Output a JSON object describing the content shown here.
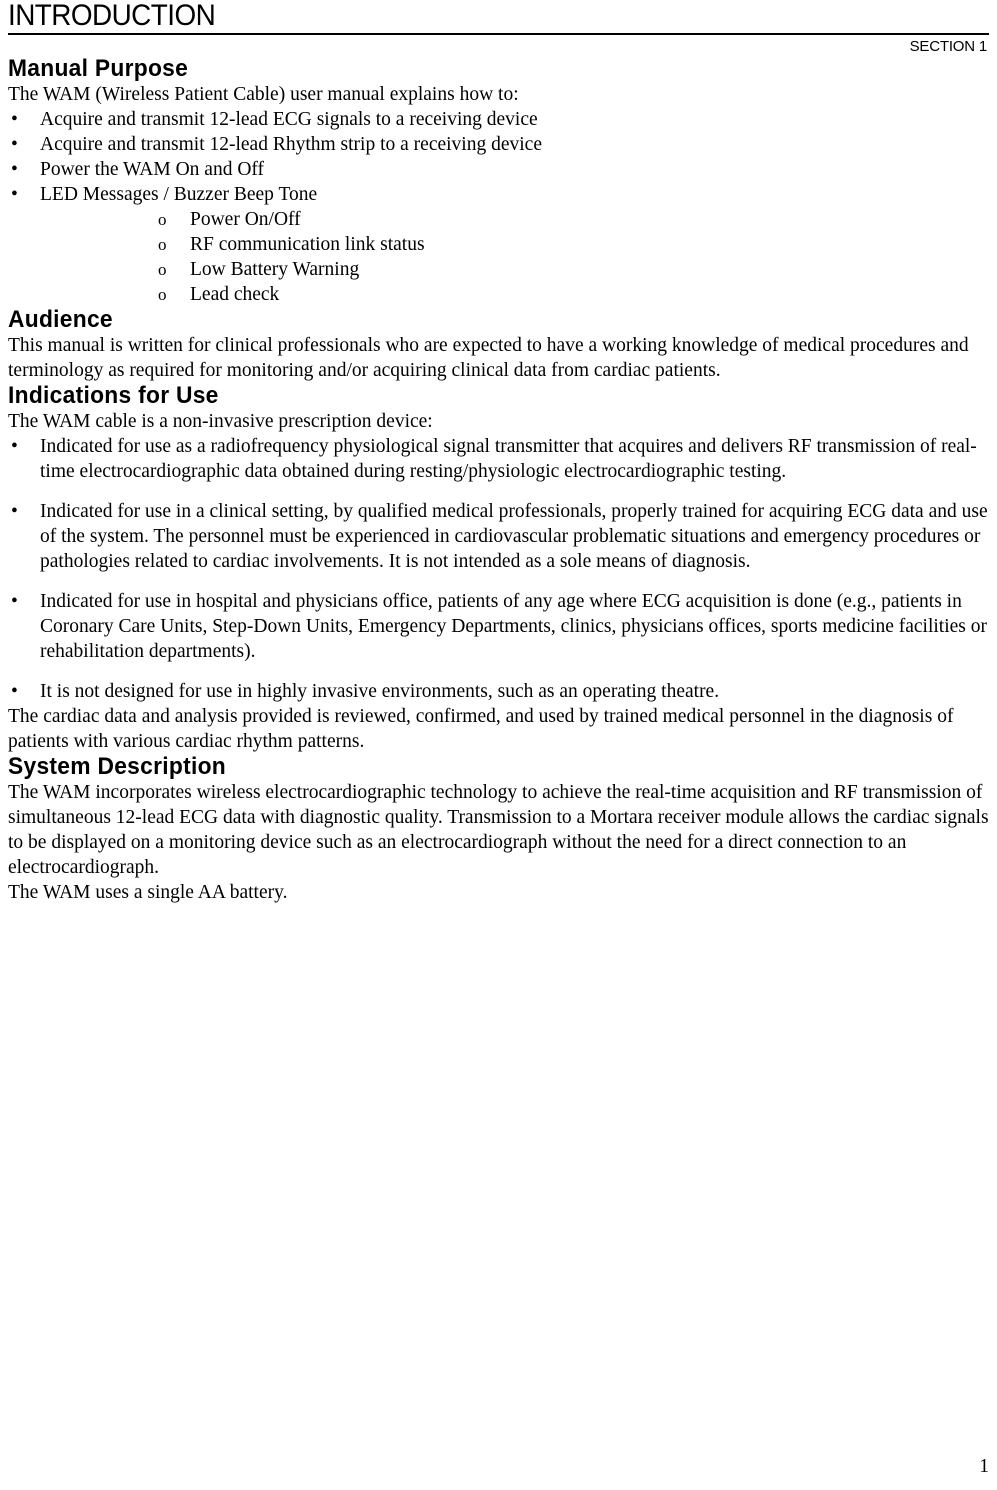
{
  "header": {
    "title": "INTRODUCTION",
    "section_label": "SECTION 1"
  },
  "sections": {
    "manual_purpose": {
      "heading": "Manual Purpose",
      "lead": "The WAM (Wireless Patient Cable) user manual explains how to:",
      "bullets": [
        "Acquire and transmit 12-lead ECG signals to a receiving device",
        "Acquire and transmit 12-lead Rhythm strip to a receiving device",
        "Power the WAM On and Off",
        "LED Messages /  Buzzer Beep Tone"
      ],
      "subbullets": [
        "Power On/Off",
        "RF communication link status",
        "Low Battery Warning",
        "Lead check"
      ]
    },
    "audience": {
      "heading": "Audience",
      "paragraph": "This manual is written for clinical professionals who are expected to have a working knowledge of medical procedures and terminology as required for monitoring and/or acquiring clinical data from cardiac patients."
    },
    "indications": {
      "heading": "Indications for Use",
      "lead": "The WAM cable is a non-invasive prescription device:",
      "bullets": [
        "Indicated for use as a radiofrequency physiological signal transmitter that acquires and delivers RF transmission of real-time electrocardiographic data obtained during resting/physiologic electrocardiographic testing.",
        "Indicated for use in a clinical setting, by qualified medical professionals, properly trained for acquiring ECG data and use of the system. The personnel must be experienced in cardiovascular problematic situations and emergency procedures or pathologies related to cardiac involvements.  It is not intended as a sole means of diagnosis.",
        "Indicated for use in hospital and physicians office, patients of any age where ECG acquisition is done (e.g., patients in Coronary Care Units, Step-Down Units, Emergency Departments, clinics, physicians offices, sports medicine facilities or rehabilitation departments).",
        "It is not designed for use in highly invasive environments, such as an operating theatre."
      ],
      "closing": "The cardiac data and analysis provided is reviewed, confirmed, and used by trained medical personnel in the diagnosis of patients with various cardiac rhythm patterns."
    },
    "system_description": {
      "heading": "System Description",
      "paragraph_1": "The WAM incorporates wireless electrocardiographic technology to achieve the real-time acquisition and RF transmission of simultaneous 12-lead ECG data with diagnostic quality.  Transmission to a Mortara receiver module allows the cardiac signals to be displayed on a monitoring device such as an electrocardiograph without the need for a direct connection to an electrocardiograph.",
      "paragraph_2": "The WAM uses a single AA battery."
    }
  },
  "markers": {
    "bullet": "•",
    "subbullet": "o"
  },
  "footer": {
    "page_number": "1"
  }
}
